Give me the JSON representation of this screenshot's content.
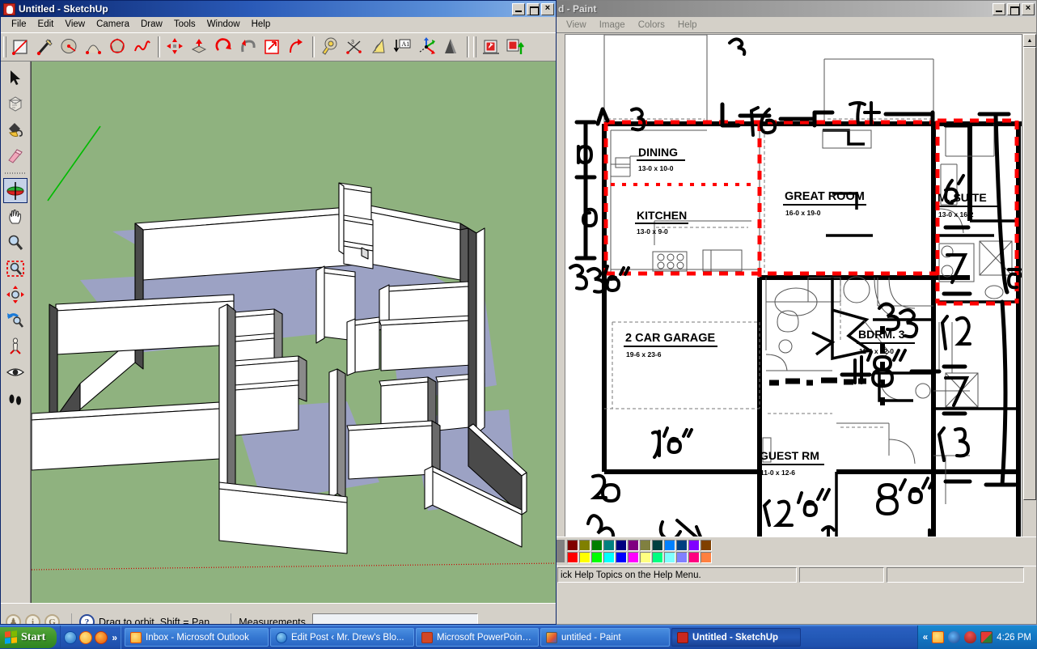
{
  "sketchup": {
    "title": "Untitled - SketchUp",
    "title_icon": "sketchup-logo-icon",
    "menus": [
      "File",
      "Edit",
      "View",
      "Camera",
      "Draw",
      "Tools",
      "Window",
      "Help"
    ],
    "window_buttons": {
      "minimize": "_",
      "maximize": "□",
      "close": "×"
    },
    "toolbar_groups": [
      {
        "name": "drawing",
        "tools": [
          "rectangle-tool-icon",
          "line-tool-icon",
          "circle-tool-icon",
          "arc-tool-icon",
          "polygon-tool-icon",
          "freehand-tool-icon"
        ]
      },
      {
        "name": "modify",
        "tools": [
          "move-tool-icon",
          "pushpull-tool-icon",
          "rotate-tool-icon",
          "followme-tool-icon",
          "scale-tool-icon",
          "offset-tool-icon"
        ]
      },
      {
        "name": "construction",
        "tools": [
          "tape-measure-icon",
          "dimension-tool-icon",
          "protractor-tool-icon",
          "text-tool-icon",
          "axes-tool-icon",
          "3dtext-tool-icon"
        ]
      },
      {
        "name": "warehouse",
        "tools": [
          "get-models-icon",
          "share-model-icon"
        ]
      }
    ],
    "left_toolbar": [
      {
        "name": "select-tool-icon",
        "selected": false
      },
      {
        "name": "make-component-icon",
        "selected": false
      },
      {
        "name": "paint-bucket-icon",
        "selected": false
      },
      {
        "name": "eraser-tool-icon",
        "selected": false
      },
      {
        "name": "orbit-tool-icon",
        "selected": true
      },
      {
        "name": "pan-tool-icon",
        "selected": false
      },
      {
        "name": "zoom-tool-icon",
        "selected": false
      },
      {
        "name": "zoom-window-icon",
        "selected": false
      },
      {
        "name": "zoom-extents-icon",
        "selected": false
      },
      {
        "name": "previous-view-icon",
        "selected": false
      },
      {
        "name": "position-camera-icon",
        "selected": false
      },
      {
        "name": "look-around-icon",
        "selected": false
      },
      {
        "name": "walk-tool-icon",
        "selected": false
      }
    ],
    "statusbar": {
      "hint": "Drag to orbit.  Shift = Pan",
      "measurements_label": "Measurements",
      "measurements_value": "",
      "icons": [
        "person-icon",
        "info-icon",
        "google-icon",
        "help-icon"
      ]
    },
    "canvas": {
      "background_color": "#8fb27f",
      "wall_color": "#ffffff",
      "floor_color": "#9ca2c4",
      "wall_shadow_color": "#4a4a4a",
      "axis_green": "#00bb00",
      "axis_red": "#cc0000"
    }
  },
  "paint": {
    "title": "d - Paint",
    "menus": [
      "View",
      "Image",
      "Colors",
      "Help"
    ],
    "window_buttons": {
      "minimize": "_",
      "maximize": "□",
      "close": "×"
    },
    "statusbar": {
      "hint": "ick Help Topics on the Help Menu.",
      "panel2": "",
      "panel3": ""
    },
    "palette": {
      "current_color": "#808080",
      "row1": [
        "#800000",
        "#808000",
        "#008000",
        "#008080",
        "#000080",
        "#800080",
        "#808040",
        "#004040",
        "#0080ff",
        "#004080",
        "#8000ff",
        "#804000"
      ],
      "row2": [
        "#ff0000",
        "#ffff00",
        "#00ff00",
        "#00ffff",
        "#0000ff",
        "#ff00ff",
        "#ffff80",
        "#00ff80",
        "#80ffff",
        "#8080ff",
        "#ff0080",
        "#ff8040"
      ]
    },
    "floorplan": {
      "rooms": [
        {
          "name": "DINING",
          "dims": "13-0 x 10-0"
        },
        {
          "name": "KITCHEN",
          "dims": "13-0 x 9-0"
        },
        {
          "name": "GREAT ROOM",
          "dims": "16-0 x 19-0"
        },
        {
          "name": "M. SUITE",
          "dims": "13-0 x 16-2"
        },
        {
          "name": "2 CAR GARAGE",
          "dims": "19-6 x 23-6"
        },
        {
          "name": "BDRM. 3",
          "dims": "11-6 x 12-0"
        },
        {
          "name": "GUEST RM",
          "dims": "11-0 x 12-6"
        }
      ],
      "annotations_top": [
        "13",
        "16",
        "17"
      ],
      "annotations_left": [
        "10",
        "9",
        "23'6\""
      ],
      "annotations_right": [
        "16'",
        "7",
        "12",
        "7",
        "13",
        "5'"
      ],
      "annotations_bottom": [
        "19'6\"",
        "12'6\"",
        "8'6\"",
        "11' 8\"",
        "23",
        "20"
      ],
      "highlight_color": "#ff0000",
      "ink_color": "#000000"
    }
  },
  "taskbar": {
    "start_label": "Start",
    "quicklaunch": [
      "internet-explorer-icon",
      "outlook-icon",
      "firefox-icon"
    ],
    "quicklaunch_more": "»",
    "tasks": [
      {
        "label": "Inbox - Microsoft Outlook",
        "icon": "outlook-icon",
        "active": false
      },
      {
        "label": "Edit Post ‹ Mr. Drew's Blo...",
        "icon": "internet-explorer-icon",
        "active": false
      },
      {
        "label": "Microsoft PowerPoint - [...",
        "icon": "powerpoint-icon",
        "active": false
      },
      {
        "label": "untitled - Paint",
        "icon": "paint-icon",
        "active": false
      },
      {
        "label": "Untitled - SketchUp",
        "icon": "sketchup-icon",
        "active": true
      }
    ],
    "tray": {
      "expand": "«",
      "icons": [
        "outlook-tray-icon",
        "network-tray-icon",
        "security-tray-icon",
        "display-tray-icon"
      ],
      "clock": "4:26 PM"
    }
  }
}
